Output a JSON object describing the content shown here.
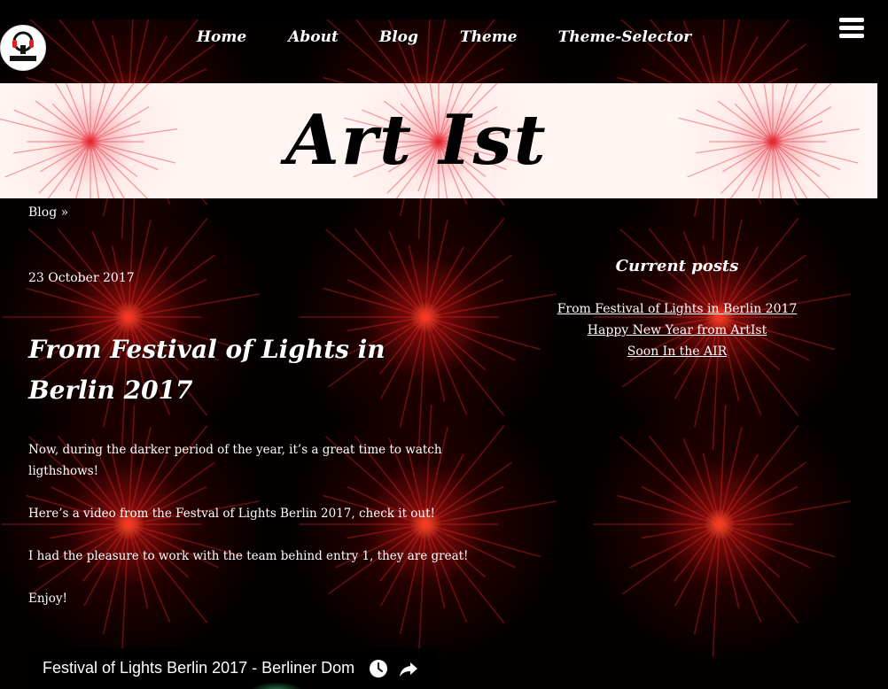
{
  "site": {
    "title": "Art Ist",
    "logo_icon": "dj-headphones-logo-icon",
    "menu_icon": "hamburger-menu-icon"
  },
  "nav": {
    "items": [
      {
        "label": "Home"
      },
      {
        "label": "About"
      },
      {
        "label": "Blog"
      },
      {
        "label": "Theme"
      },
      {
        "label": "Theme-Selector"
      }
    ]
  },
  "breadcrumb": {
    "label": "Blog »"
  },
  "post": {
    "date": "23 October 2017",
    "title": "From Festival of Lights in Berlin 2017",
    "paragraphs": [
      "Now, during the darker period of the year, it’s a great time to watch ligthshows!",
      "Here’s a video from the Festval of Lights Berlin 2017, check it out!",
      "I had the pleasure to work with the team behind entry 1, they are great!",
      "Enjoy!"
    ]
  },
  "sidebar": {
    "heading": "Current posts",
    "links": [
      {
        "label": "From Festival of Lights in Berlin 2017"
      },
      {
        "label": "Happy New Year from ArtIst"
      },
      {
        "label": "Soon In the AIR"
      }
    ]
  },
  "video": {
    "title": "Festival of Lights Berlin 2017 - Berliner Dom",
    "watch_later_icon": "clock-icon",
    "share_icon": "share-arrow-icon"
  },
  "colors": {
    "background": "#000000",
    "accent_red": "#e0201e",
    "text": "#ffffff",
    "banner_bg": "#fff6f4"
  }
}
